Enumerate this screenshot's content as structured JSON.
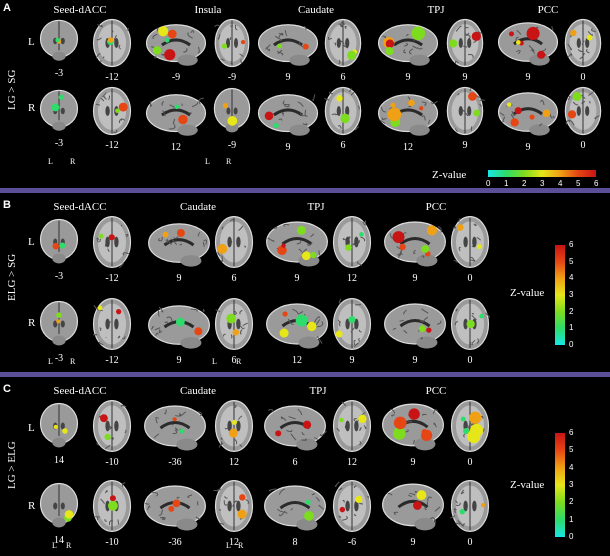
{
  "colors": {
    "divider": "#5b4f9a",
    "background": "#000000",
    "colormap": [
      "#19e6e6",
      "#2ddc6a",
      "#7ddc1e",
      "#e6e619",
      "#f0a014",
      "#e64614",
      "#c81414"
    ]
  },
  "panel_a": {
    "letter": "A",
    "side_label": "LG > SG",
    "headers": [
      "Seed-dACC",
      "Insula",
      "Caudate",
      "TPJ",
      "PCC"
    ],
    "hemis": [
      "L",
      "R"
    ],
    "row_l_numbers": [
      "-3",
      "-12",
      "-9",
      "-9",
      "9",
      "6",
      "9",
      "9",
      "9",
      "0"
    ],
    "row_r_numbers": [
      "-3",
      "-12",
      "12",
      "-9",
      "9",
      "6",
      "12",
      "9",
      "9",
      "0"
    ],
    "lr_marks": [
      "L",
      "R"
    ],
    "zvalue_label": "Z-value",
    "ticks": [
      "0",
      "1",
      "2",
      "3",
      "4",
      "5",
      "6"
    ]
  },
  "panel_b": {
    "letter": "B",
    "side_label": "ELG > SG",
    "headers": [
      "Seed-dACC",
      "Caudate",
      "TPJ",
      "PCC"
    ],
    "hemis": [
      "L",
      "R"
    ],
    "row_l_numbers": [
      "-3",
      "-12",
      "9",
      "6",
      "9",
      "12",
      "9",
      "0"
    ],
    "row_r_numbers": [
      "-3",
      "-12",
      "9",
      "6",
      "12",
      "9",
      "9",
      "0"
    ],
    "lr_marks": [
      "L",
      "R"
    ],
    "zvalue_label": "Z-value",
    "ticks": [
      "0",
      "1",
      "2",
      "3",
      "4",
      "5",
      "6"
    ]
  },
  "panel_c": {
    "letter": "C",
    "side_label": "LG > ELG",
    "headers": [
      "Seed-dACC",
      "Caudate",
      "TPJ",
      "PCC"
    ],
    "hemis": [
      "L",
      "R"
    ],
    "row_l_numbers": [
      "14",
      "-10",
      "-36",
      "12",
      "6",
      "12",
      "9",
      "0"
    ],
    "row_r_numbers": [
      "14",
      "-10",
      "-36",
      "12",
      "8",
      "-6",
      "9",
      "0"
    ],
    "lr_marks": [
      "L",
      "R"
    ],
    "zvalue_label": "Z-value",
    "ticks": [
      "0",
      "1",
      "2",
      "3",
      "4",
      "5",
      "6"
    ]
  }
}
